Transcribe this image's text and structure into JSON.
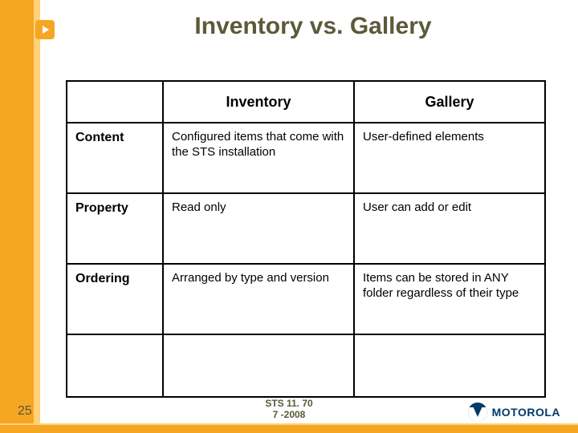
{
  "title": "Inventory vs. Gallery",
  "table": {
    "headers": {
      "col1": "Inventory",
      "col2": "Gallery"
    },
    "rows": [
      {
        "label": "Content",
        "col1": "Configured items that come with the STS installation",
        "col2": "User-defined elements"
      },
      {
        "label": "Property",
        "col1": "Read only",
        "col2": "User can add or edit"
      },
      {
        "label": "Ordering",
        "col1": "Arranged by type and version",
        "col2": "Items can be stored in ANY folder regardless of their type"
      }
    ]
  },
  "footer": {
    "page": "25",
    "product_line1": "STS 11. 70",
    "product_line2": "7 -2008",
    "brand": "MOTOROLA"
  }
}
